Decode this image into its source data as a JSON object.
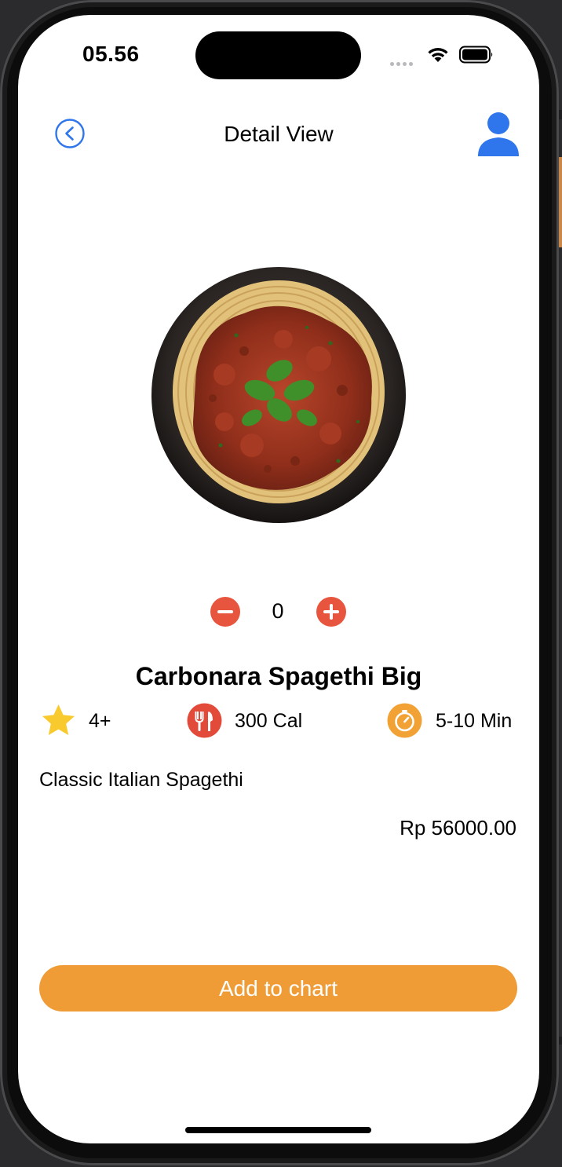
{
  "status_bar": {
    "time": "05.56"
  },
  "nav": {
    "title": "Detail View",
    "back_icon": "chevron-left-circle-icon",
    "profile_icon": "person-icon"
  },
  "product": {
    "image": "spaghetti-bolognese-plate",
    "quantity": "0",
    "name": "Carbonara Spagethi Big",
    "rating": "4+",
    "calories": "300 Cal",
    "time": "5-10 Min",
    "description": "Classic Italian Spagethi",
    "price": "Rp 56000.00"
  },
  "actions": {
    "add_label": "Add to chart"
  },
  "colors": {
    "accent_blue": "#2f76ec",
    "button_orange": "#f09c36",
    "stepper_red": "#e8553f",
    "star_yellow": "#f8ca2e",
    "calorie_red": "#e24a3a",
    "timer_orange": "#f2a234"
  }
}
